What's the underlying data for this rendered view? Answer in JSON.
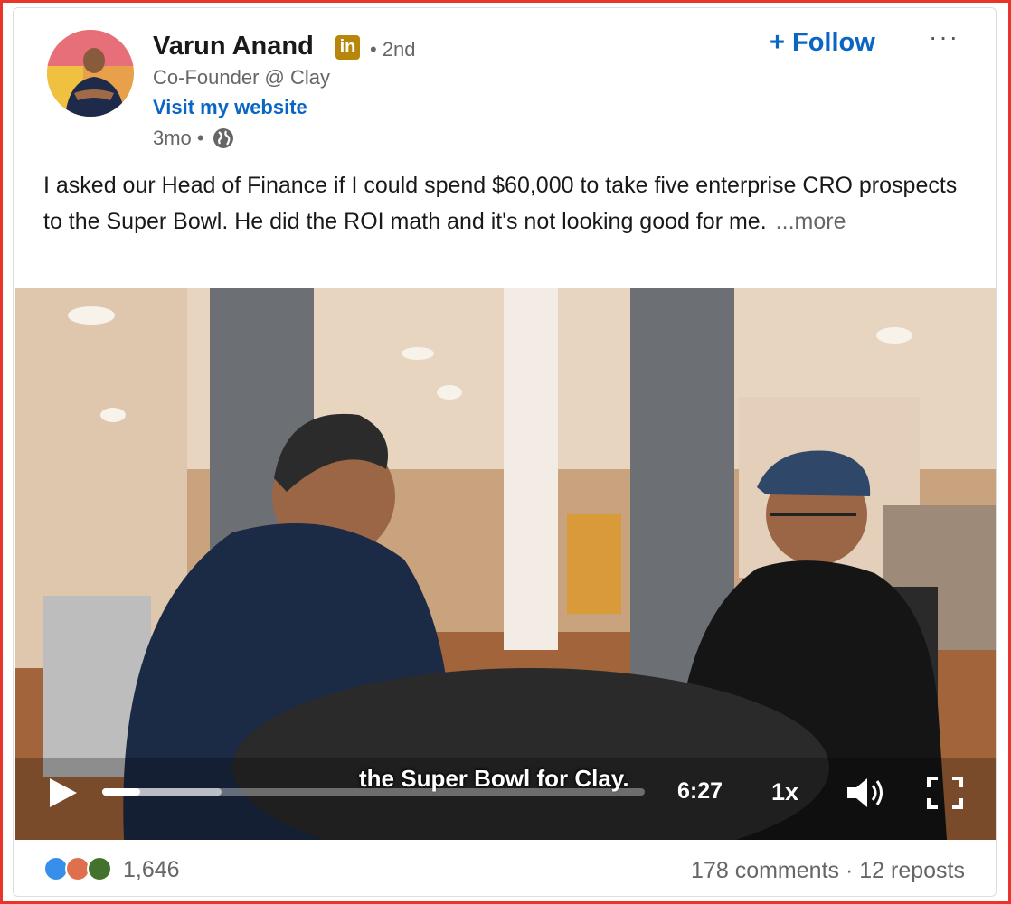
{
  "author": {
    "name": "Varun Anand",
    "badge": "in",
    "degree": "• 2nd",
    "headline": "Co-Founder @ Clay",
    "website_link": "Visit my website",
    "timestamp": "3mo •"
  },
  "actions": {
    "follow_label": "+ Follow",
    "more_label": "···"
  },
  "post": {
    "text": "I asked our Head of Finance if I could spend $60,000 to take five enterprise CRO prospects to the Super Bowl. He did the ROI math and it's not looking good for me.",
    "see_more": "...more"
  },
  "video": {
    "caption": "the Super Bowl for Clay.",
    "time_remaining": "6:27",
    "speed": "1x",
    "progress_fraction": 0.07,
    "buffered_fraction": 0.22
  },
  "engagement": {
    "reaction_count": "1,646",
    "comments": "178 comments",
    "separator": "·",
    "reposts": "12 reposts"
  },
  "colors": {
    "accent": "#0a66c2",
    "frame_border": "#e8352b",
    "linkedin_badge": "#b8860b"
  }
}
